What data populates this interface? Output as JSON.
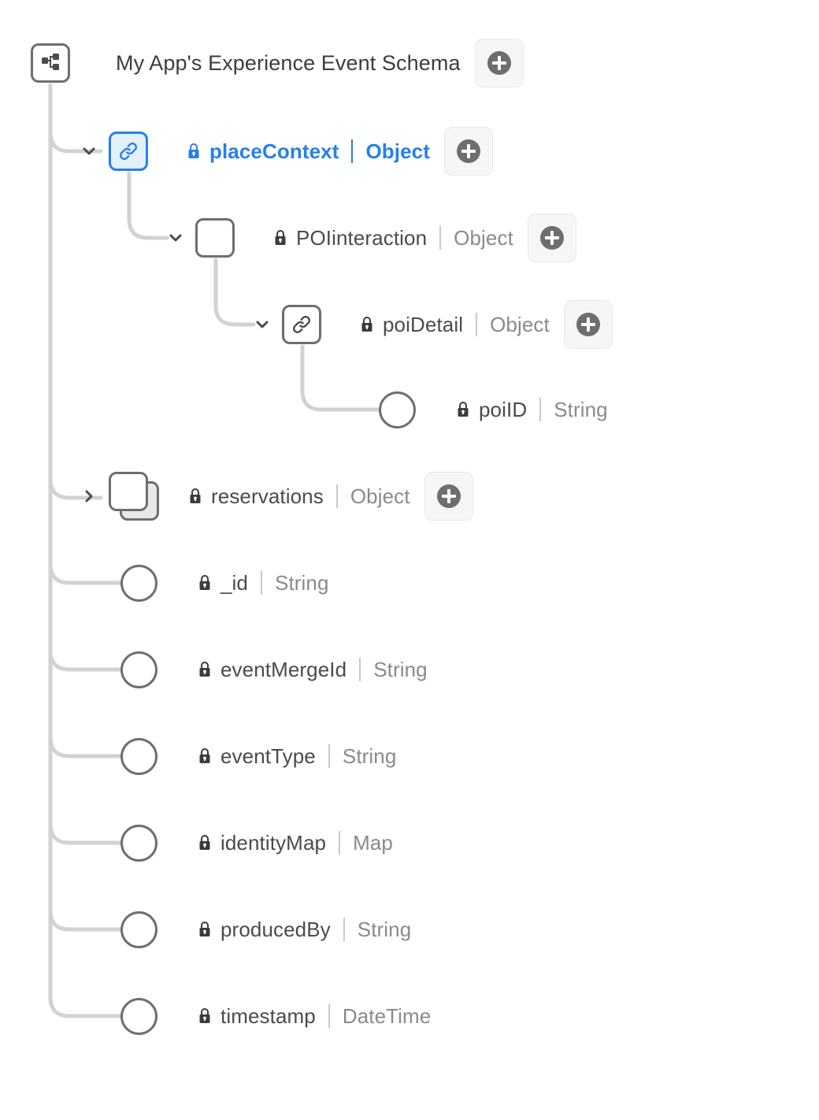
{
  "root": {
    "title": "My App's Experience Event Schema",
    "icon": "schema-icon",
    "add_button": "add-field-button"
  },
  "colors": {
    "accent_blue": "#2680EB",
    "accent_blue_fill": "#E3F0FD",
    "node_stroke": "#6E6E6E",
    "connector": "#D2D2D2",
    "text_primary": "#4B4B4B",
    "text_type": "#8A8A8A",
    "plus_circle": "#6E6E6E",
    "plus_bg": "#F6F6F6"
  },
  "nodes": [
    {
      "id": "placeContext",
      "name": "placeContext",
      "type": "Object",
      "glyph": "link",
      "locked": true,
      "selected": true,
      "expanded": true,
      "has_add": true,
      "depth": 1
    },
    {
      "id": "POIinteraction",
      "name": "POIinteraction",
      "type": "Object",
      "glyph": "square",
      "locked": true,
      "selected": false,
      "expanded": true,
      "has_add": true,
      "depth": 2
    },
    {
      "id": "poiDetail",
      "name": "poiDetail",
      "type": "Object",
      "glyph": "link",
      "locked": true,
      "selected": false,
      "expanded": true,
      "has_add": true,
      "depth": 3
    },
    {
      "id": "poiID",
      "name": "poiID",
      "type": "String",
      "glyph": "circle",
      "locked": true,
      "selected": false,
      "expanded": null,
      "has_add": false,
      "depth": 4
    },
    {
      "id": "reservations",
      "name": "reservations",
      "type": "Object",
      "glyph": "stack",
      "locked": true,
      "selected": false,
      "expanded": false,
      "has_add": true,
      "depth": 1
    },
    {
      "id": "_id",
      "name": "_id",
      "type": "String",
      "glyph": "circle",
      "locked": true,
      "selected": false,
      "expanded": null,
      "has_add": false,
      "depth": 1
    },
    {
      "id": "eventMergeId",
      "name": "eventMergeId",
      "type": "String",
      "glyph": "circle",
      "locked": true,
      "selected": false,
      "expanded": null,
      "has_add": false,
      "depth": 1
    },
    {
      "id": "eventType",
      "name": "eventType",
      "type": "String",
      "glyph": "circle",
      "locked": true,
      "selected": false,
      "expanded": null,
      "has_add": false,
      "depth": 1
    },
    {
      "id": "identityMap",
      "name": "identityMap",
      "type": "Map",
      "glyph": "circle",
      "locked": true,
      "selected": false,
      "expanded": null,
      "has_add": false,
      "depth": 1
    },
    {
      "id": "producedBy",
      "name": "producedBy",
      "type": "String",
      "glyph": "circle",
      "locked": true,
      "selected": false,
      "expanded": null,
      "has_add": false,
      "depth": 1
    },
    {
      "id": "timestamp",
      "name": "timestamp",
      "type": "DateTime",
      "glyph": "circle",
      "locked": true,
      "selected": false,
      "expanded": null,
      "has_add": false,
      "depth": 1
    }
  ]
}
